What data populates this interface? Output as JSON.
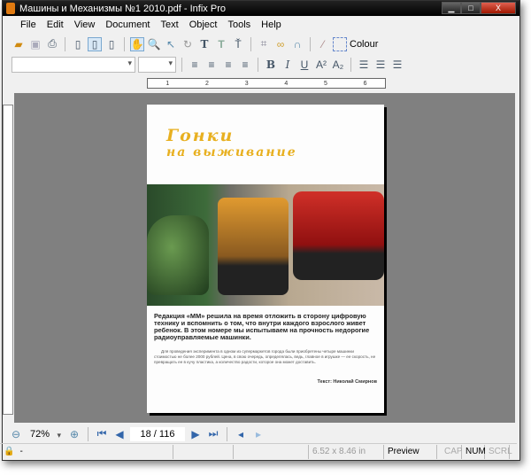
{
  "window": {
    "title": "Машины и Механизмы №1 2010.pdf - Infix Pro"
  },
  "menu": [
    "File",
    "Edit",
    "View",
    "Document",
    "Text",
    "Object",
    "Tools",
    "Help"
  ],
  "toolbar": {
    "colour_label": "Colour"
  },
  "ruler": [
    "1",
    "2",
    "3",
    "4",
    "5",
    "6"
  ],
  "page": {
    "title_line1": "Гонки",
    "title_line2": "на выживание",
    "lead": "Редакция «ММ» решила на время отложить в сторону цифровую технику и вспомнить о том, что внутри каждого взрослого живет ребенок. В этом номере мы испытываем на прочность недорогие радиоуправляемые машинки.",
    "body": "Для проведения эксперимента в одном из супермаркетов города были приобретены четыре машинки стоимостью не более 2000 рублей. Цена, в свою очередь, определялась, ведь, главное в игрушке — ее скорость, не превращать ее в кучу пластика, а количество радости, которое она может доставить.",
    "author": "Текст: Николай Смирнов"
  },
  "nav": {
    "zoom": "72%",
    "page": "18 / 116"
  },
  "status": {
    "lock": "-",
    "size": "6.52 x 8.46 in",
    "mode": "Preview",
    "cap": "CAP",
    "num": "NUM",
    "scrl": "SCRL"
  }
}
